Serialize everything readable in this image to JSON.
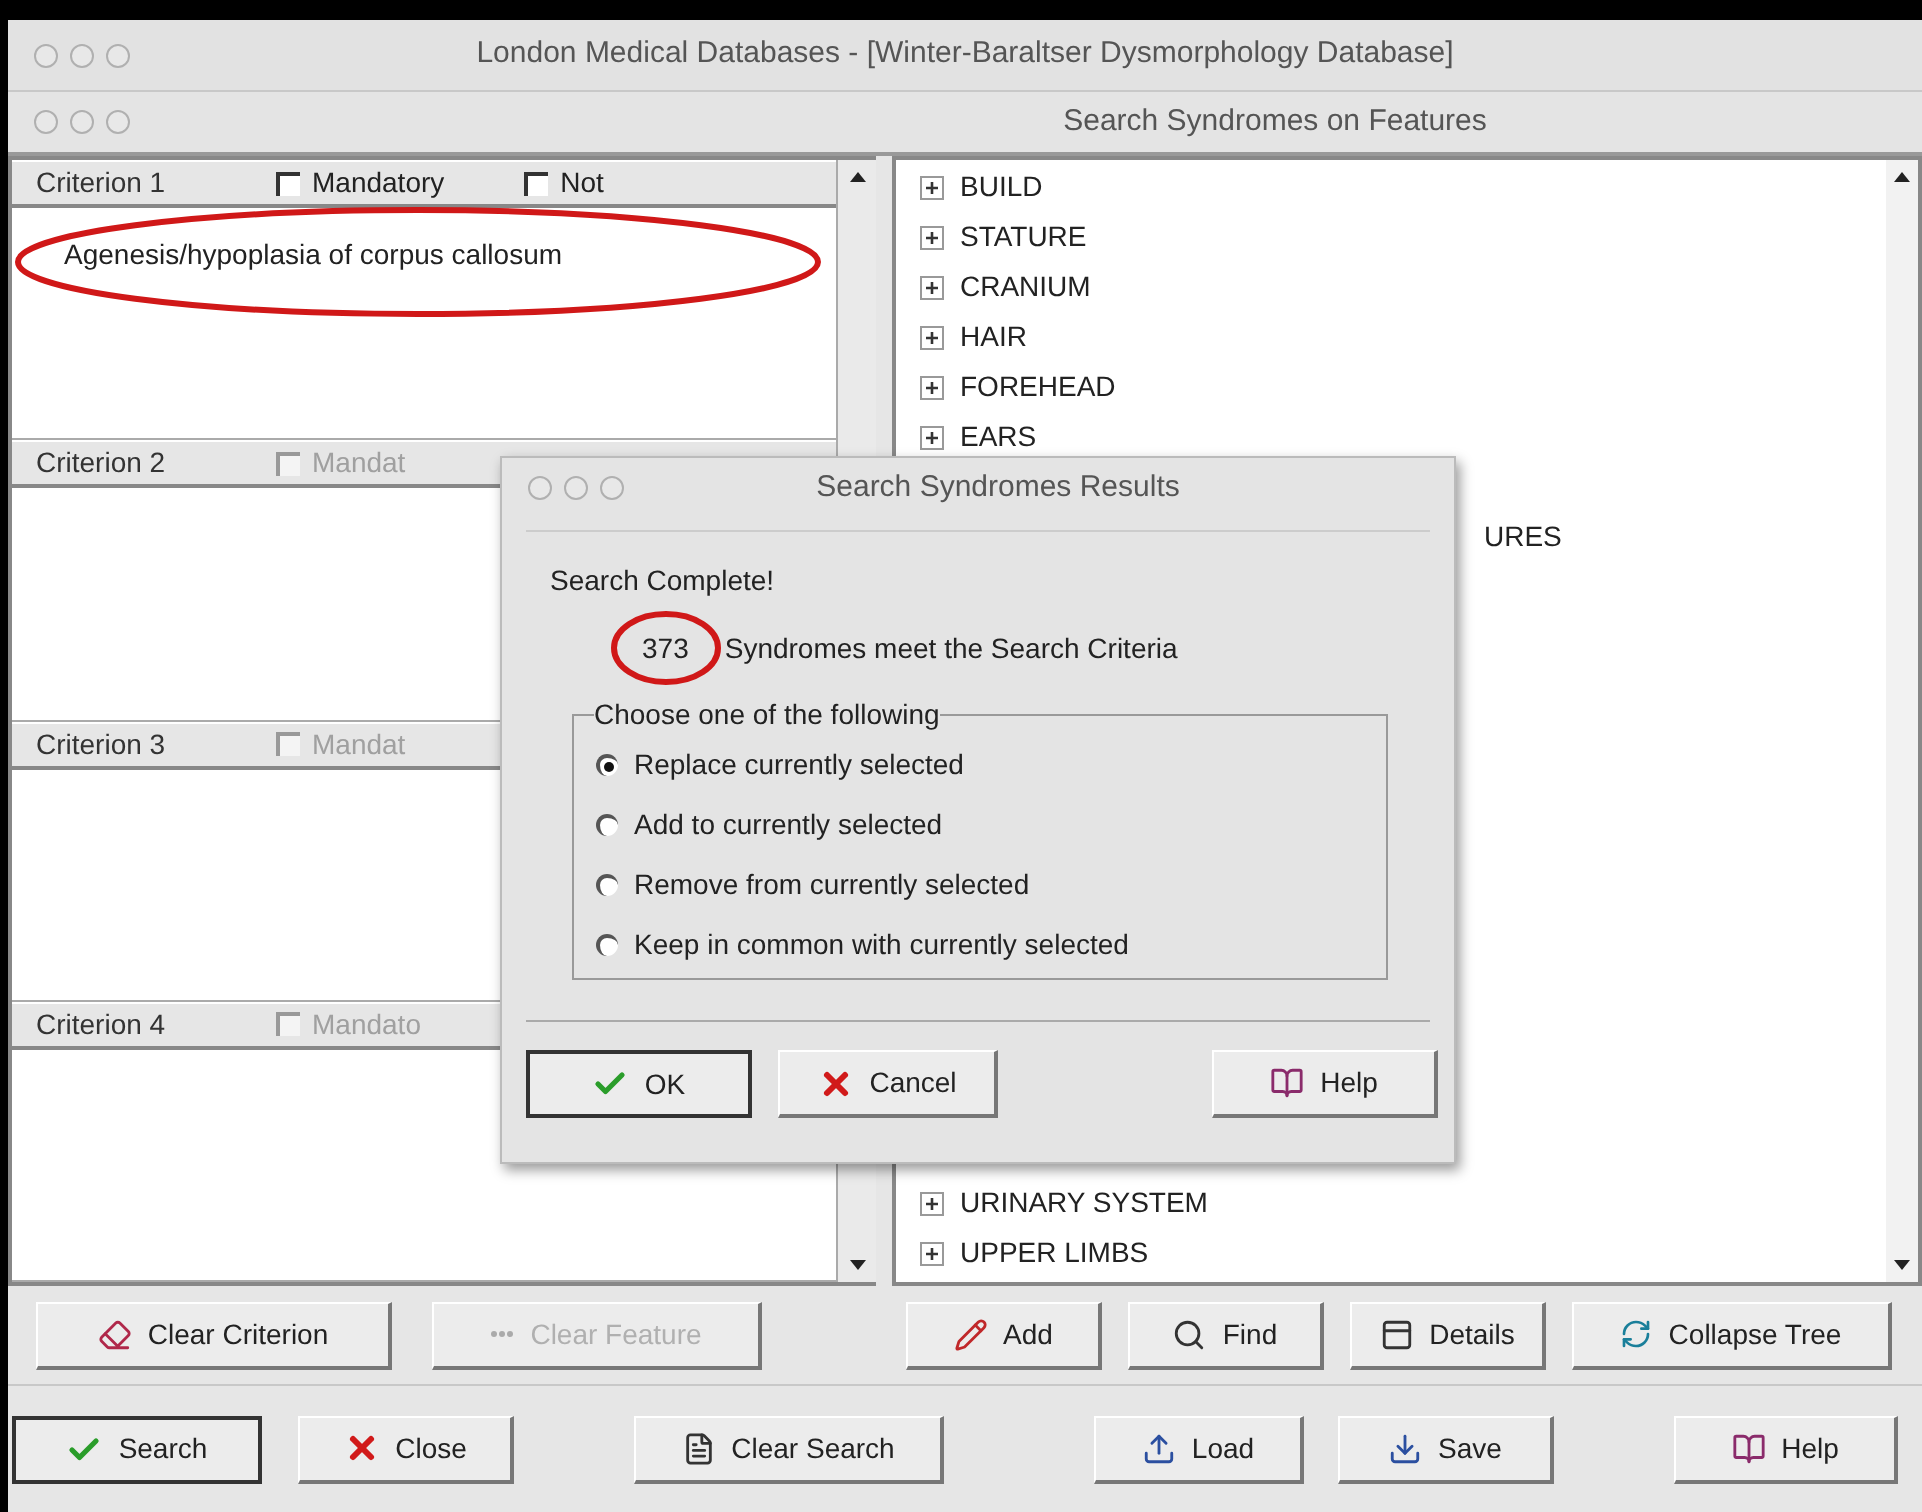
{
  "app_title": "London Medical Databases - [Winter-Baraltser Dysmorphology Database]",
  "window": {
    "title": "Search Syndromes on Features"
  },
  "criteria": [
    {
      "label": "Criterion 1",
      "value": "Agenesis/hypoplasia of corpus callosum",
      "options": [
        {
          "label": "Mandatory",
          "checked": false,
          "disabled": false
        },
        {
          "label": "Not",
          "checked": false,
          "disabled": false
        }
      ]
    },
    {
      "label": "Criterion 2",
      "options": [
        {
          "label": "Mandat",
          "checked": false,
          "disabled": true
        }
      ]
    },
    {
      "label": "Criterion 3",
      "options": [
        {
          "label": "Mandat",
          "checked": false,
          "disabled": true
        }
      ]
    },
    {
      "label": "Criterion 4",
      "options": [
        {
          "label": "Mandato",
          "checked": false,
          "disabled": true
        }
      ]
    }
  ],
  "tree_top": [
    "BUILD",
    "STATURE",
    "CRANIUM",
    "HAIR",
    "FOREHEAD",
    "EARS"
  ],
  "tree_partial": "URES",
  "tree_bottom": [
    "URINARY SYSTEM",
    "UPPER LIMBS"
  ],
  "criterion_buttons": [
    {
      "label": "Clear Criterion",
      "kind": "eraser",
      "disabled": false
    },
    {
      "label": "Clear Feature",
      "kind": "dots",
      "disabled": true
    }
  ],
  "tree_buttons": [
    {
      "label": "Add",
      "kind": "add",
      "disabled": false
    },
    {
      "label": "Find",
      "kind": "find",
      "disabled": false
    },
    {
      "label": "Details",
      "kind": "details",
      "disabled": false
    },
    {
      "label": "Collapse Tree",
      "kind": "collapse",
      "disabled": false
    }
  ],
  "bottom_buttons": [
    {
      "label": "Search",
      "kind": "check",
      "default": true
    },
    {
      "label": "Close",
      "kind": "x",
      "default": false
    },
    {
      "label": "Clear Search",
      "kind": "file",
      "default": false
    },
    {
      "label": "Load",
      "kind": "load",
      "default": false
    },
    {
      "label": "Save",
      "kind": "save",
      "default": false
    },
    {
      "label": "Help",
      "kind": "help",
      "default": false
    }
  ],
  "dialog": {
    "title": "Search Syndromes Results",
    "heading": "Search Complete!",
    "count": "373",
    "message": "Syndromes meet the Search Criteria",
    "group_label": "Choose one of the following",
    "choices": [
      {
        "label": "Replace currently selected",
        "selected": true
      },
      {
        "label": "Add to currently selected",
        "selected": false
      },
      {
        "label": "Remove from currently selected",
        "selected": false
      },
      {
        "label": "Keep in common with currently selected",
        "selected": false
      }
    ],
    "buttons": [
      {
        "label": "OK",
        "kind": "check",
        "default": true
      },
      {
        "label": "Cancel",
        "kind": "x",
        "default": false
      },
      {
        "label": "Help",
        "kind": "help",
        "default": false
      }
    ]
  }
}
